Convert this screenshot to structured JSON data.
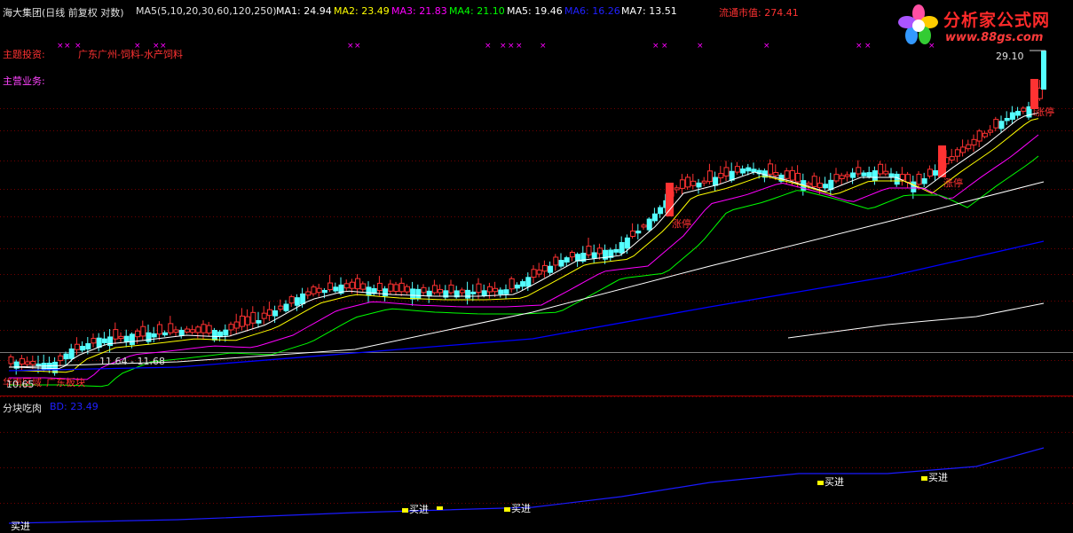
{
  "header": {
    "title": "海大集团(日线 前复权 对数)",
    "ma_params": "MA5(5,10,20,30,60,120,250)",
    "ma1": "MA1: 24.94",
    "ma2": "MA2: 23.49",
    "ma3": "MA3: 21.83",
    "ma4": "MA4: 21.10",
    "ma5": "MA5: 19.46",
    "ma6": "MA6: 16.26",
    "ma7": "MA7: 13.51",
    "market_cap": "流通市值: 274.41"
  },
  "logo": {
    "name": "分析家公式网",
    "url": "www.88gs.com"
  },
  "info": {
    "theme_label": "主题投资:",
    "theme_value": "广东广州-饲料-水产饲料",
    "business_label": "主营业务:",
    "region": "广东板块",
    "zone": "华南区域"
  },
  "price_labels": {
    "high": "29.10",
    "low": "10.65",
    "mid_range": "11.64 - 11.68"
  },
  "limit_up_label": "涨停",
  "sub_panel": {
    "title": "分块吃肉",
    "bd_value": "BD: 23.49",
    "buy_label": "买进"
  },
  "colors": {
    "background": "#000000",
    "up": "#ff3232",
    "down": "#54ffff",
    "grid": "#700000",
    "ma1": "#ffffff",
    "ma2": "#ffff00",
    "ma3": "#ff00ff",
    "ma4": "#00ff00",
    "ma5": "#ffffff",
    "ma6": "#0000ff",
    "ma7": "#ffffff",
    "market_cap": "#ff3232"
  }
}
